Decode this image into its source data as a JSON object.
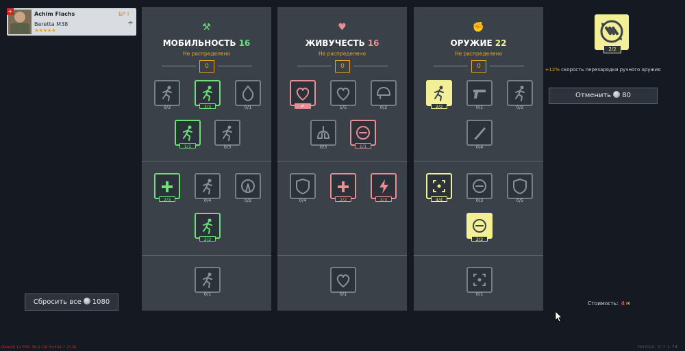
{
  "soldier": {
    "name": "Achim Flachs",
    "rank": "БР I",
    "weapon": "Beretta M38",
    "stars": "★★★★★",
    "icons": {
      "flag": "country-flag-icon",
      "portrait": "soldier-portrait",
      "parachute": "parachute-icon"
    }
  },
  "columns": [
    {
      "title": "МОБИЛЬНОСТЬ",
      "points": "16",
      "points_color": "#6ee07a",
      "header_icon": "boot-icon",
      "unassigned_label": "Не распределено",
      "unassigned_value": "0",
      "skills": [
        {
          "icon": "climb-stairs-icon",
          "progress": "0/2",
          "state": "plain"
        },
        {
          "icon": "crawl-under-wire-icon",
          "progress": "3/3",
          "state": "green"
        },
        {
          "icon": "fire-resist-icon",
          "progress": "0/1",
          "state": "plain"
        },
        {
          "icon": "crouch-speed-icon",
          "progress": "1/1",
          "state": "green"
        },
        {
          "icon": "throw-gas-icon",
          "progress": "0/3",
          "state": "plain"
        },
        {
          "icon": "fast-heal-icon",
          "progress": "2/3",
          "state": "green"
        },
        {
          "icon": "vault-climb-icon",
          "progress": "0/4",
          "state": "plain"
        },
        {
          "icon": "shockwave-icon",
          "progress": "0/2",
          "state": "plain"
        },
        {
          "icon": "sprint-icon",
          "progress": "2/2",
          "state": "green"
        },
        {
          "icon": "dash-run-icon",
          "progress": "0/1",
          "state": "plain"
        }
      ]
    },
    {
      "title": "ЖИВУЧЕСТЬ",
      "points": "16",
      "points_color": "#e88e95",
      "header_icon": "heart-icon",
      "unassigned_label": "Не распределено",
      "unassigned_value": "0",
      "skills": [
        {
          "icon": "heartbeat-icon",
          "progress": "✔",
          "state": "redfill"
        },
        {
          "icon": "heart-regen-icon",
          "progress": "1/5",
          "state": "plain"
        },
        {
          "icon": "helmet-icon",
          "progress": "0/2",
          "state": "plain"
        },
        {
          "icon": "lungs-icon",
          "progress": "0/3",
          "state": "plain"
        },
        {
          "icon": "stamina-regen-icon",
          "progress": "1/1",
          "state": "red"
        },
        {
          "icon": "armor-shield-icon",
          "progress": "0/4",
          "state": "plain"
        },
        {
          "icon": "health-up-icon",
          "progress": "2/2",
          "state": "red"
        },
        {
          "icon": "energy-up-icon",
          "progress": "3/3",
          "state": "red"
        },
        {
          "icon": "heart-upgrade-icon",
          "progress": "0/1",
          "state": "plain"
        }
      ]
    },
    {
      "title": "ОРУЖИЕ",
      "points": "22",
      "points_color": "#f2ef96",
      "header_icon": "fist-icon",
      "unassigned_label": "Не распределено",
      "unassigned_value": "0",
      "skills": [
        {
          "icon": "swing-melee-icon",
          "progress": "2/2",
          "state": "yellowfill"
        },
        {
          "icon": "pistol-swap-icon",
          "progress": "0/1",
          "state": "plain"
        },
        {
          "icon": "grenade-climb-icon",
          "progress": "0/2",
          "state": "plain"
        },
        {
          "icon": "knife-icon",
          "progress": "0/4",
          "state": "plain"
        },
        {
          "icon": "aim-focus-icon",
          "progress": "4/4",
          "state": "yellow"
        },
        {
          "icon": "reload-speed-icon",
          "progress": "0/3",
          "state": "plain"
        },
        {
          "icon": "medic-shield-icon",
          "progress": "0/5",
          "state": "plain"
        },
        {
          "icon": "ammo-reload-icon",
          "progress": "2/2",
          "state": "yellowfill"
        },
        {
          "icon": "target-focus-icon",
          "progress": "0/1",
          "state": "plain"
        }
      ]
    }
  ],
  "selected_skill": {
    "icon": "ammo-reload-icon",
    "progress": "2/2",
    "description_pct": "+12%",
    "description_text": " скорость перезарядки ручного оружия"
  },
  "cancel": {
    "label": "Отменить",
    "cost": "80",
    "icon": "silver-coin-icon"
  },
  "reset": {
    "label": "Сбросить все",
    "cost": "1080",
    "icon": "silver-coin-icon"
  },
  "cost": {
    "label": "Стоимость:",
    "value": "4",
    "icon": "scroll-icon"
  },
  "fps_text": "DirectX 11 FPS: 36.0 (16.3<334.7 27.8)",
  "version_text": "version: 0.7.1.74",
  "colors": {
    "green": "#6ee07a",
    "red": "#e88e95",
    "yellow": "#f2ef96",
    "gold": "#e8a820"
  }
}
